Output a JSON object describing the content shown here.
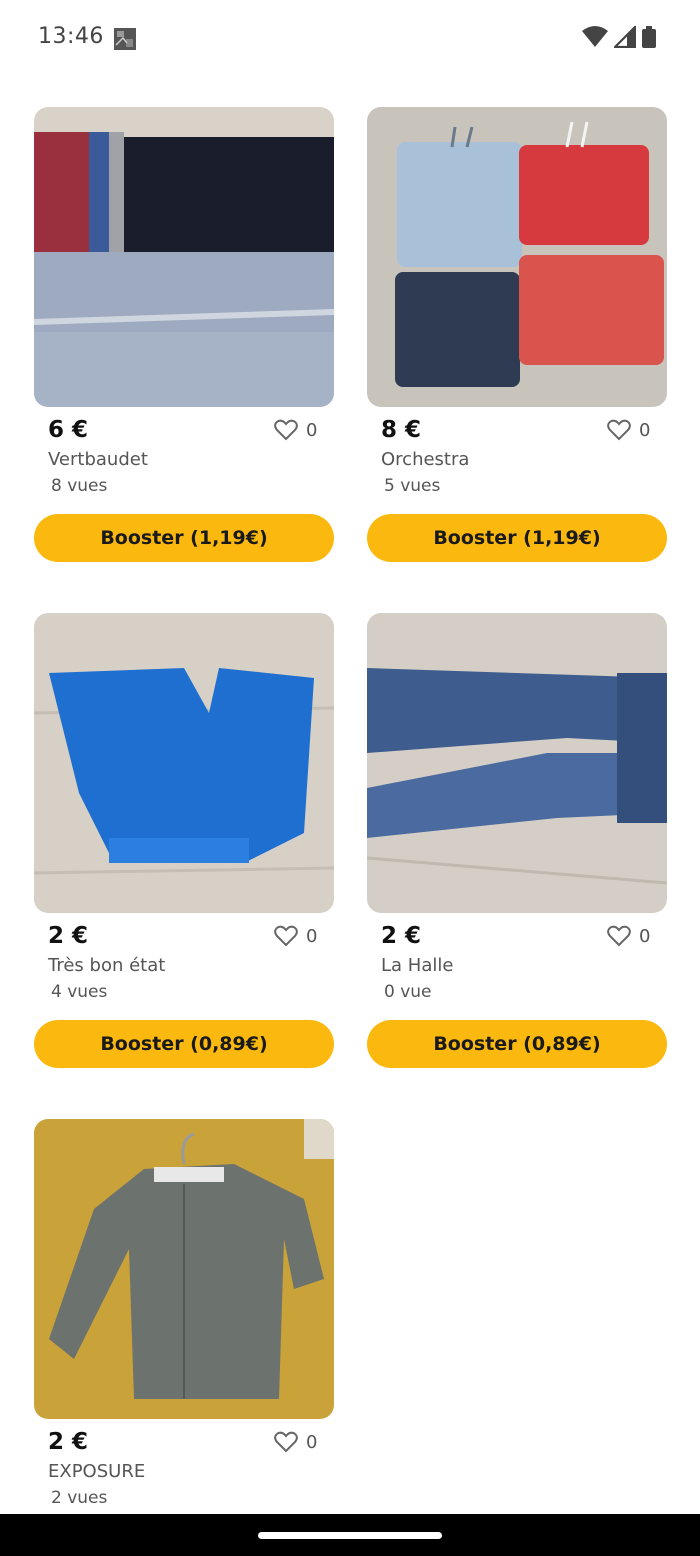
{
  "status_bar": {
    "time": "13:46",
    "icons": [
      "notification-photo-icon",
      "wifi-icon",
      "signal-icon",
      "battery-icon"
    ]
  },
  "listings": [
    {
      "price": "6 €",
      "brand": "Vertbaudet",
      "views": "8 vues",
      "likes": "0",
      "boost_label": "Booster (1,19€)",
      "image": "navy and grey striped pants"
    },
    {
      "price": "8 €",
      "brand": "Orchestra",
      "views": "5 vues",
      "likes": "0",
      "boost_label": "Booster (1,19€)",
      "image": "four shorts in denim and red"
    },
    {
      "price": "2 €",
      "brand": "Très bon état",
      "views": "4 vues",
      "likes": "0",
      "boost_label": "Booster (0,89€)",
      "image": "blue wide shorts"
    },
    {
      "price": "2 €",
      "brand": "La Halle",
      "views": "0 vue",
      "likes": "0",
      "boost_label": "Booster (0,89€)",
      "image": "blue jeans"
    },
    {
      "price": "2 €",
      "brand": "EXPOSURE",
      "views": "2 vues",
      "likes": "0",
      "boost_label": "",
      "image": "khaki shirt on hanger"
    }
  ],
  "colors": {
    "boost_button": "#fbb90f",
    "text_primary": "#111111",
    "text_secondary": "#555555"
  }
}
